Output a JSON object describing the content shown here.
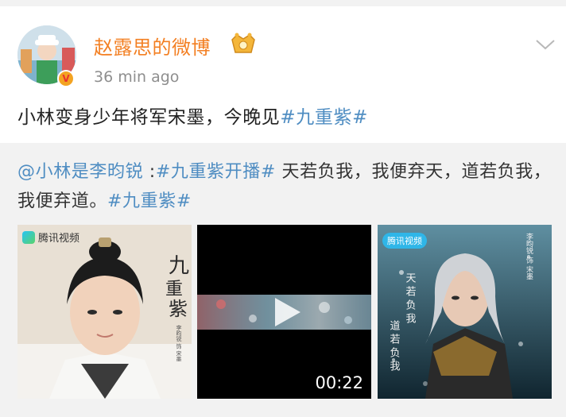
{
  "post": {
    "username": "赵露思的微博",
    "timestamp": "36 min ago",
    "text": "小林变身少年将军宋墨，今晚见",
    "hashtag": "#九重紫#"
  },
  "repost": {
    "author_mention": "@小林是李昀锐",
    "sep": " :",
    "topic1": "#九重紫开播#",
    "body": " 天若负我，我便弃天，道若负我，我便弃道。",
    "topic2": "#九重紫#",
    "images": [
      {
        "platform_logo": "腾讯视频",
        "title_art": "九重紫",
        "credit": "李昀锐 饰 宋墨"
      },
      {
        "video_duration": "00:22"
      },
      {
        "platform_logo": "腾讯视频",
        "credit": "李昀锐 饰 宋墨",
        "quote_line1": "天若负我，我便弃天",
        "quote_line2": "道若负我，我"
      }
    ]
  },
  "colors": {
    "username": "#f37f22",
    "link": "#4f8dc2",
    "repost_bg": "#f2f2f2"
  },
  "icons": [
    "avatar",
    "verified-badge-icon",
    "vip-badge-icon",
    "chevron-down-icon",
    "play-icon"
  ]
}
